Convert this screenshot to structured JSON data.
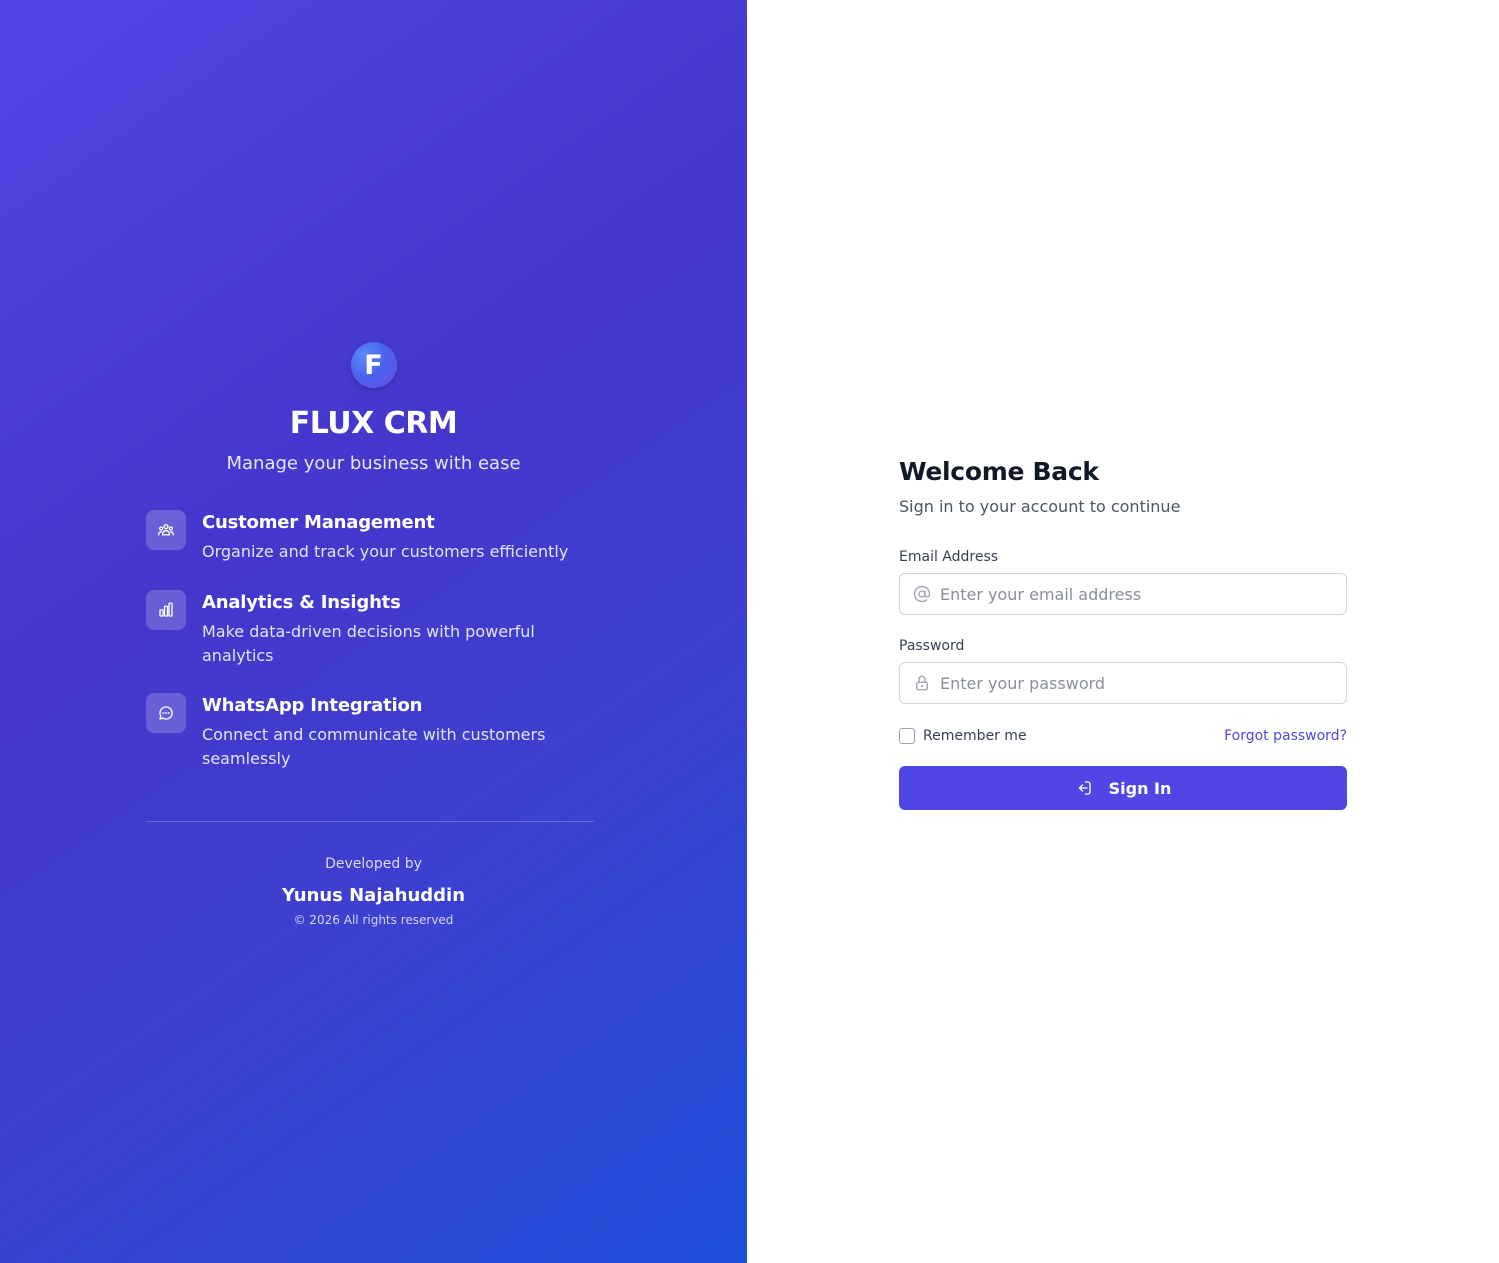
{
  "brand": {
    "logo_letter": "F",
    "title": "FLUX CRM",
    "tagline": "Manage your business with ease"
  },
  "features": [
    {
      "icon": "users-icon",
      "title": "Customer Management",
      "description": "Organize and track your customers efficiently"
    },
    {
      "icon": "bar-chart-icon",
      "title": "Analytics & Insights",
      "description": "Make data-driven decisions with powerful analytics"
    },
    {
      "icon": "chat-bubble-icon",
      "title": "WhatsApp Integration",
      "description": "Connect and communicate with customers seamlessly"
    }
  ],
  "footer": {
    "developed_by": "Developed by",
    "developer_name": "Yunus Najahuddin",
    "copyright": "© 2026 All rights reserved"
  },
  "login": {
    "title": "Welcome Back",
    "subtitle": "Sign in to your account to continue",
    "email_label": "Email Address",
    "email_placeholder": "Enter your email address",
    "email_value": "",
    "password_label": "Password",
    "password_placeholder": "Enter your password",
    "password_value": "",
    "remember_label": "Remember me",
    "remember_checked": false,
    "forgot_label": "Forgot password?",
    "signin_label": "Sign In"
  },
  "colors": {
    "accent": "#4f46e5",
    "panel_gradient_start": "#5046e5",
    "panel_gradient_end": "#1f4fdb"
  }
}
